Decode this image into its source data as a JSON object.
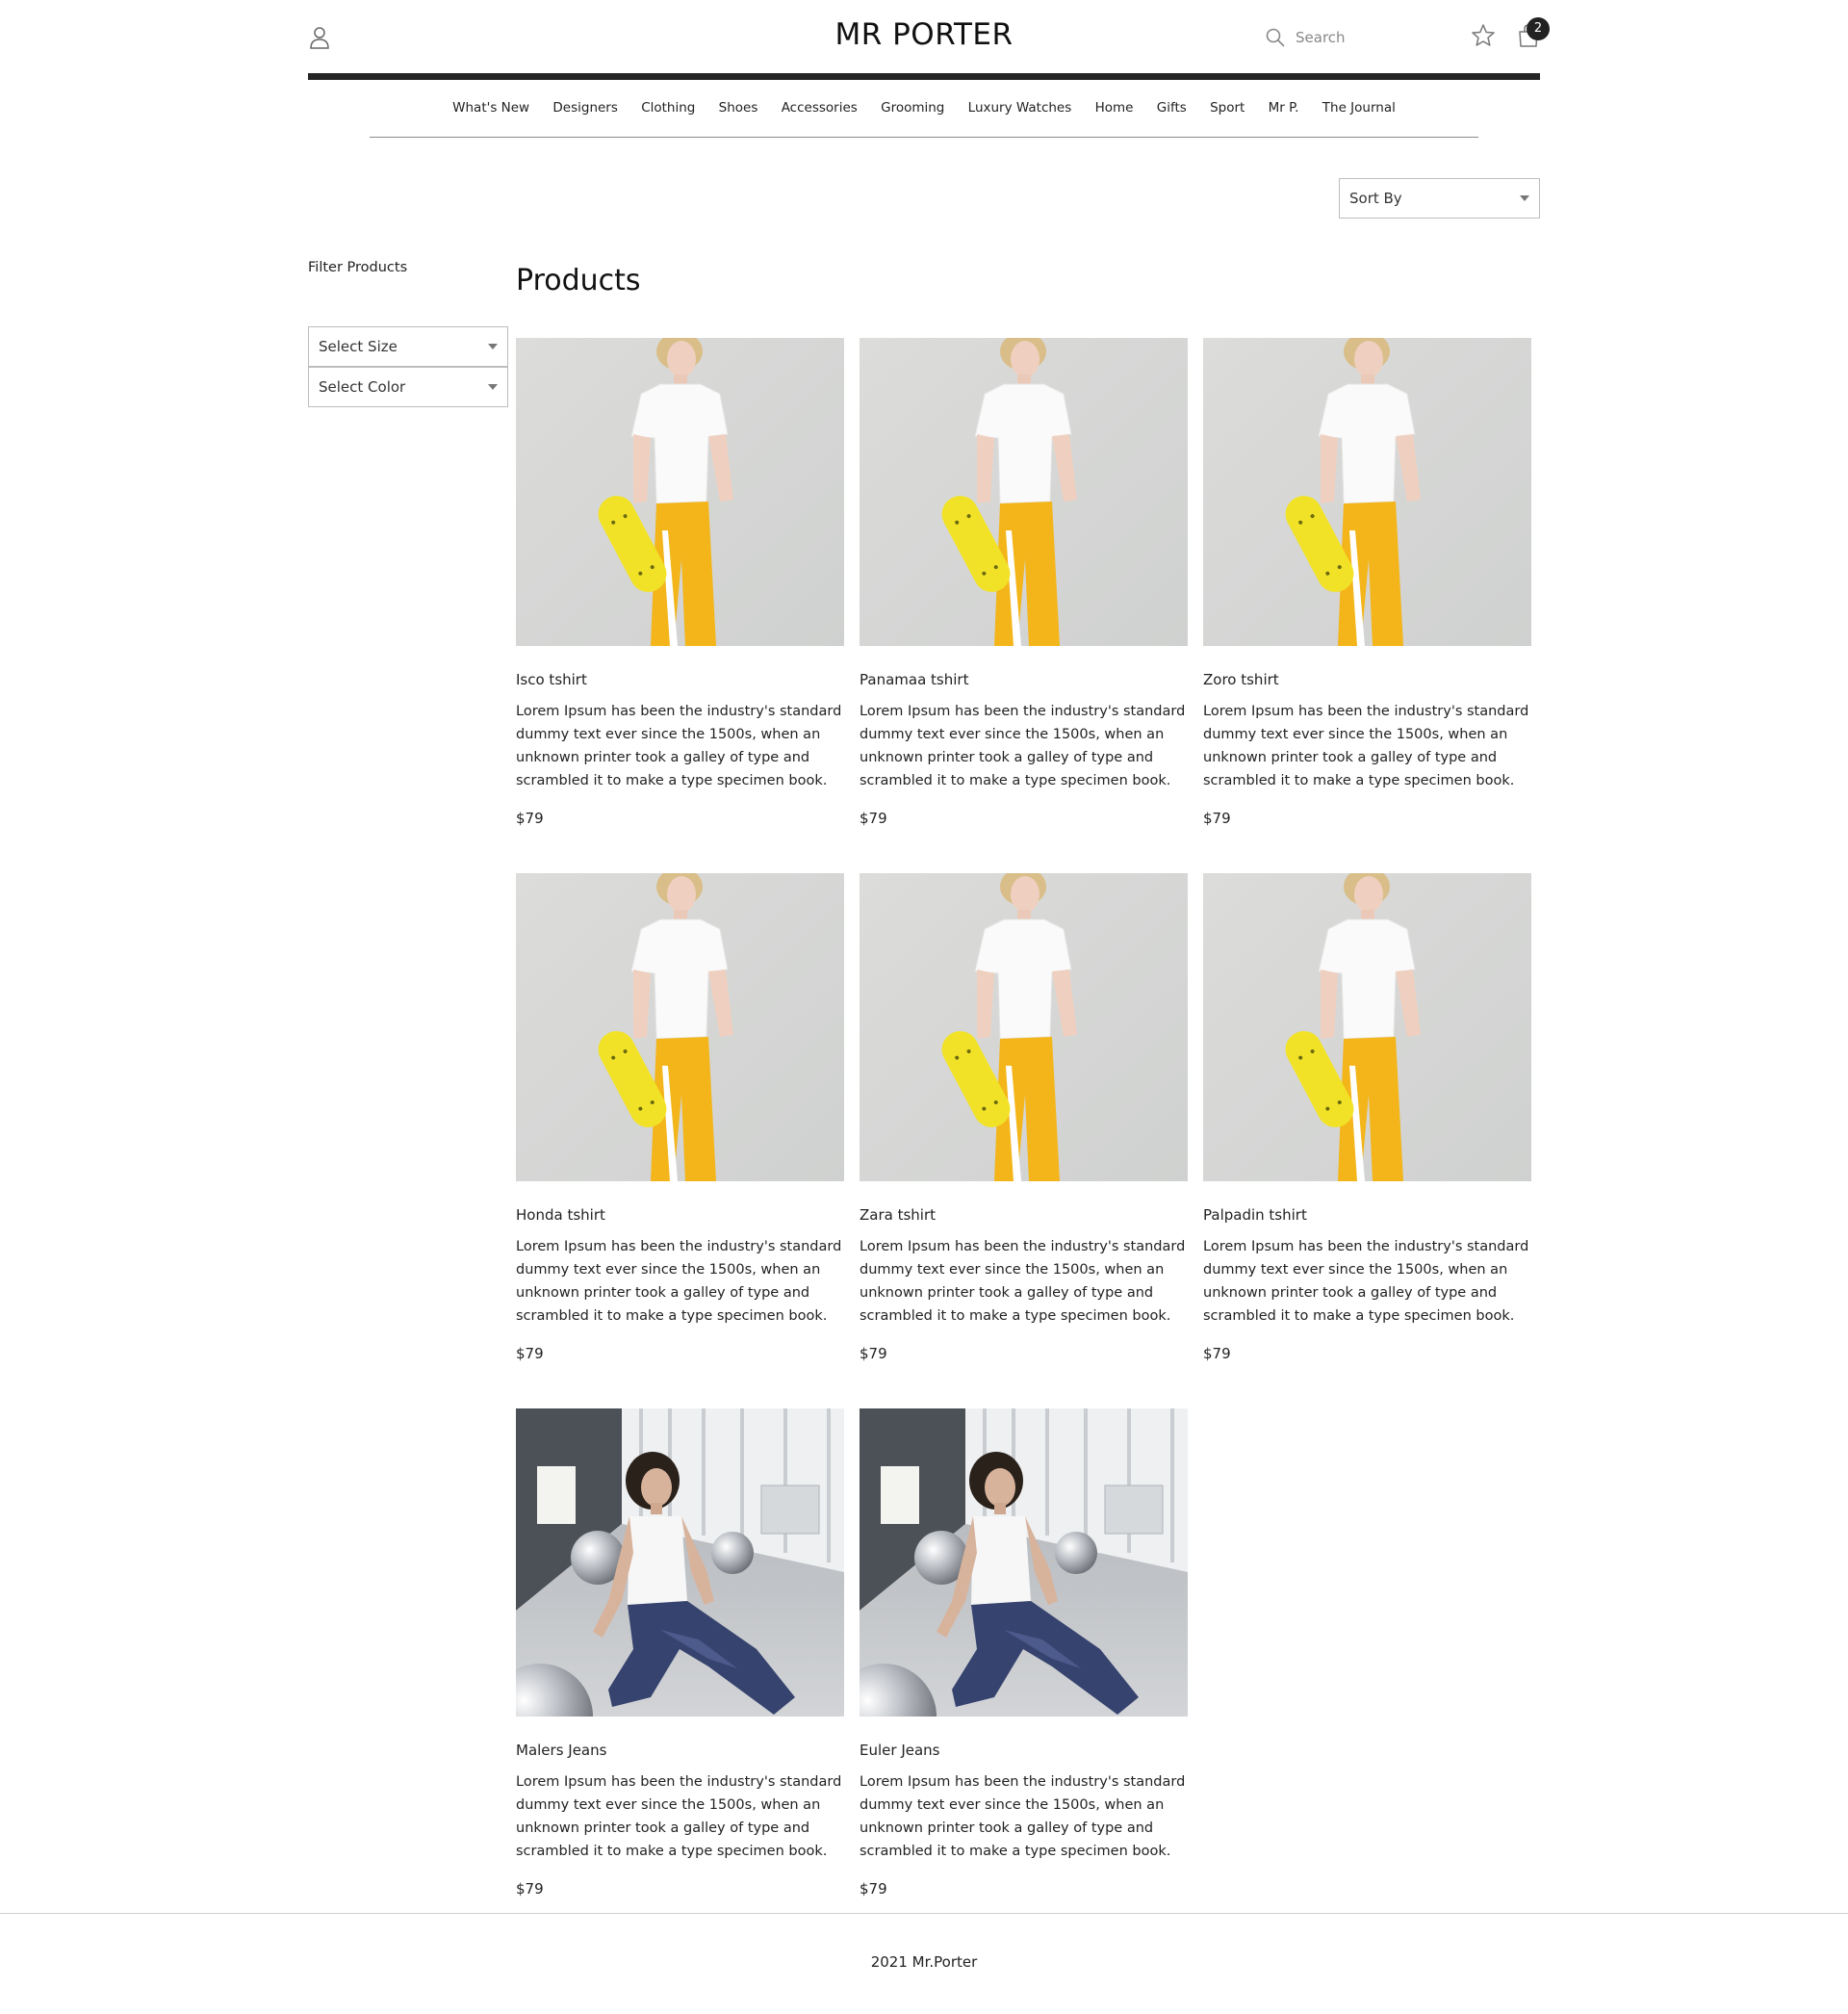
{
  "header": {
    "brand": "MR PORTER",
    "search_placeholder": "Search",
    "cart_count": "2",
    "icons": [
      "user-icon",
      "search-icon",
      "star-icon",
      "shopping-bag-icon"
    ]
  },
  "nav": {
    "items": [
      "What's New",
      "Designers",
      "Clothing",
      "Shoes",
      "Accessories",
      "Grooming",
      "Luxury Watches",
      "Home",
      "Gifts",
      "Sport",
      "Mr P.",
      "The Journal"
    ]
  },
  "sort": {
    "label": "Sort By"
  },
  "filters": {
    "title": "Filter Products",
    "size_label": "Select Size",
    "color_label": "Select Color"
  },
  "products": {
    "title": "Products",
    "items": [
      {
        "name": "Isco tshirt",
        "description": "Lorem Ipsum has been the industry's standard dummy text ever since the 1500s, when an unknown printer took a galley of type and scrambled it to make a type specimen book.",
        "price": "$79",
        "image": "tshirt"
      },
      {
        "name": "Panamaa tshirt",
        "description": "Lorem Ipsum has been the industry's standard dummy text ever since the 1500s, when an unknown printer took a galley of type and scrambled it to make a type specimen book.",
        "price": "$79",
        "image": "tshirt"
      },
      {
        "name": "Zoro tshirt",
        "description": "Lorem Ipsum has been the industry's standard dummy text ever since the 1500s, when an unknown printer took a galley of type and scrambled it to make a type specimen book.",
        "price": "$79",
        "image": "tshirt"
      },
      {
        "name": "Honda tshirt",
        "description": "Lorem Ipsum has been the industry's standard dummy text ever since the 1500s, when an unknown printer took a galley of type and scrambled it to make a type specimen book.",
        "price": "$79",
        "image": "tshirt"
      },
      {
        "name": "Zara tshirt",
        "description": "Lorem Ipsum has been the industry's standard dummy text ever since the 1500s, when an unknown printer took a galley of type and scrambled it to make a type specimen book.",
        "price": "$79",
        "image": "tshirt"
      },
      {
        "name": "Palpadin tshirt",
        "description": "Lorem Ipsum has been the industry's standard dummy text ever since the 1500s, when an unknown printer took a galley of type and scrambled it to make a type specimen book.",
        "price": "$79",
        "image": "tshirt"
      },
      {
        "name": "Malers Jeans",
        "description": "Lorem Ipsum has been the industry's standard dummy text ever since the 1500s, when an unknown printer took a galley of type and scrambled it to make a type specimen book.",
        "price": "$79",
        "image": "jeans"
      },
      {
        "name": "Euler Jeans",
        "description": "Lorem Ipsum has been the industry's standard dummy text ever since the 1500s, when an unknown printer took a galley of type and scrambled it to make a type specimen book.",
        "price": "$79",
        "image": "jeans"
      }
    ]
  },
  "footer": {
    "text": "2021 Mr.Porter"
  },
  "colors": {
    "header_bar": "#252525",
    "badge": "#222222",
    "border": "#bdbdbd"
  }
}
